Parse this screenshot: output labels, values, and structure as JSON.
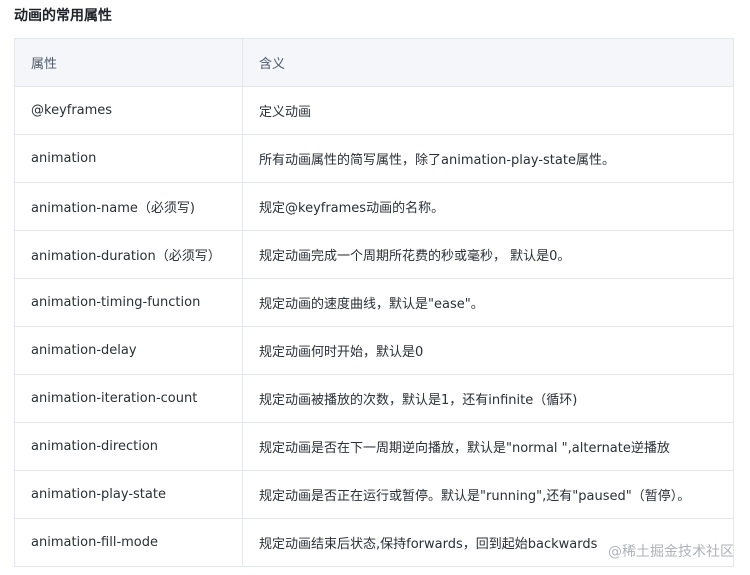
{
  "title": "动画的常用属性",
  "table": {
    "headers": [
      "属性",
      "含义"
    ],
    "rows": [
      [
        "@keyframes",
        "定义动画"
      ],
      [
        "animation",
        "所有动画属性的简写属性，除了animation-play-state属性。"
      ],
      [
        "animation-name（必须写)",
        "规定@keyframes动画的名称。"
      ],
      [
        "animation-duration（必须写）",
        "规定动画完成一个周期所花费的秒或毫秒，  默认是0。"
      ],
      [
        "animation-timing-function",
        "规定动画的速度曲线，默认是\"ease\"。"
      ],
      [
        "animation-delay",
        "规定动画何时开始，默认是0"
      ],
      [
        "animation-iteration-count",
        "规定动画被播放的次数，默认是1，还有infinite（循环)"
      ],
      [
        "animation-direction",
        "规定动画是否在下一周期逆向播放，默认是\"normal \",alternate逆播放"
      ],
      [
        "animation-play-state",
        "规定动画是否正在运行或暂停。默认是\"running\",还有\"paused\"（暂停）。"
      ],
      [
        "animation-fill-mode",
        "规定动画结束后状态,保持forwards，回到起始backwards"
      ]
    ]
  },
  "watermark": "@稀土掘金技术社区"
}
